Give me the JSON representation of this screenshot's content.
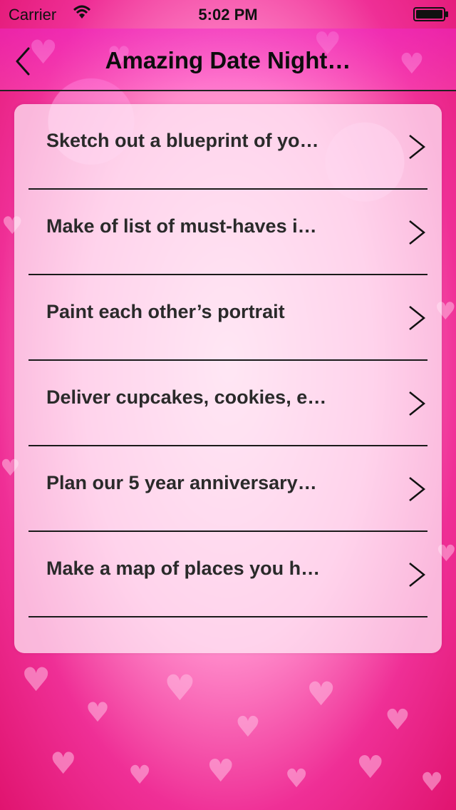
{
  "status_bar": {
    "carrier": "Carrier",
    "time": "5:02 PM",
    "wifi_icon": "wifi-icon",
    "battery_icon": "battery-icon"
  },
  "nav_bar": {
    "title": "Amazing Date Night…",
    "back_icon": "back-chevron-icon"
  },
  "list": {
    "items": [
      {
        "label": "Sketch out a blueprint of yo…"
      },
      {
        "label": "Make of list of must-haves i…"
      },
      {
        "label": "Paint each other’s portrait"
      },
      {
        "label": "Deliver cupcakes, cookies, e…"
      },
      {
        "label": "Plan our 5 year anniversary…"
      },
      {
        "label": "Make a map of places you h…"
      }
    ],
    "disclosure_icon": "chevron-right-icon"
  },
  "colors": {
    "nav_tint": "#f028c8",
    "background_pink": "#ef2f96",
    "text": "#2a2a2a"
  }
}
